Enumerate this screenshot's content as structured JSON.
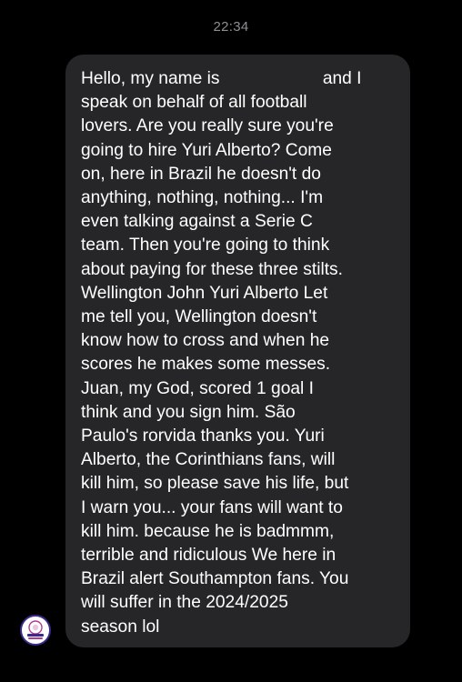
{
  "conversation": {
    "timestamp": "22:34",
    "message": {
      "before_name": "Hello, my name is",
      "after_name": " and I\nspeak on behalf of all football\nlovers. Are you really sure you're\ngoing to hire Yuri Alberto? Come\non, here in Brazil he doesn't do\nanything, nothing, nothing... I'm\neven talking against a Serie C\nteam. Then you're going to think\nabout paying for these three stilts.\nWellington John Yuri Alberto Let\nme tell you, Wellington doesn't\nknow how to cross and when he\nscores he makes some messes.\nJuan, my God, scored 1 goal I\nthink and you sign him. São\nPaulo's rorvida thanks you. Yuri\nAlberto, the Corinthians fans, will\nkill him, so please save his life, but\nI warn you... your fans will want to\nkill him. because he is badmmm,\nterrible and ridiculous We here in\nBrazil alert Southampton fans. You\nwill suffer in the 2024/2025\nseason lol"
    },
    "sender_avatar_icon": "sender-avatar-icon"
  },
  "colors": {
    "background": "#000000",
    "bubble": "#262628",
    "text": "#ffffff",
    "timestamp": "#8e8e93"
  }
}
